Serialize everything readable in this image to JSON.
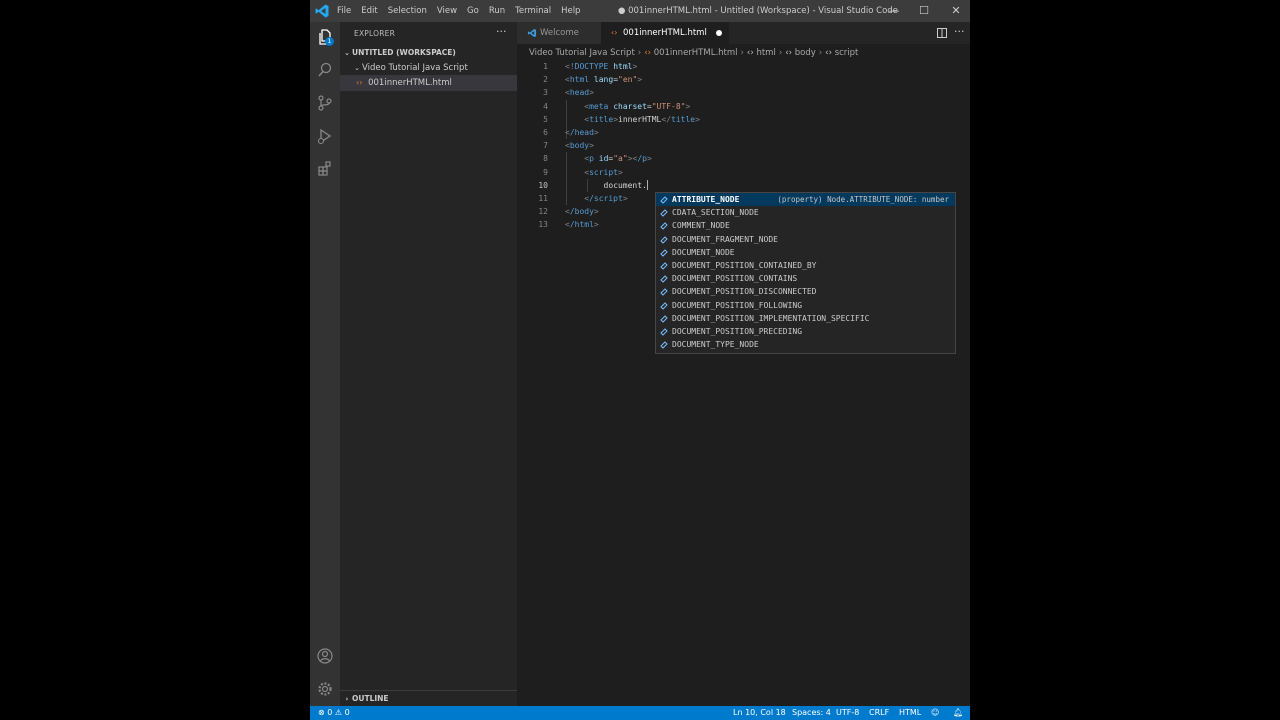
{
  "window": {
    "title": "● 001innerHTML.html - Untitled (Workspace) - Visual Studio Code",
    "menu": [
      "File",
      "Edit",
      "Selection",
      "View",
      "Go",
      "Run",
      "Terminal",
      "Help"
    ],
    "controls": {
      "minimize": "—",
      "maximize": "☐",
      "close": "✕"
    }
  },
  "activity_bar": {
    "explorer_badge": "1",
    "icons": [
      "files-icon",
      "search-icon",
      "source-control-icon",
      "run-debug-icon",
      "extensions-icon",
      "account-icon",
      "settings-gear-icon"
    ]
  },
  "sidebar": {
    "title": "EXPLORER",
    "more": "···",
    "workspace": "UNTITLED (WORKSPACE)",
    "folder": "Video Tutorial Java Script",
    "file": "001innerHTML.html",
    "outline": "OUTLINE"
  },
  "tabs": [
    {
      "label": "Welcome",
      "active": false
    },
    {
      "label": "001innerHTML.html",
      "active": true,
      "dirty": true
    }
  ],
  "breadcrumb": [
    "Video Tutorial Java Script",
    "001innerHTML.html",
    "html",
    "body",
    "script"
  ],
  "editor": {
    "line_numbers": [
      "1",
      "2",
      "3",
      "4",
      "5",
      "6",
      "7",
      "8",
      "9",
      "10",
      "11",
      "12",
      "13"
    ],
    "current_line": 10,
    "code": {
      "l1_open": "<!",
      "l1_kw": "DOCTYPE",
      "l1_attr": "html",
      "l1_close": ">",
      "l2_tag": "html",
      "l2_attr": "lang",
      "l2_val": "\"en\"",
      "l3_tag": "head",
      "l4_tag": "meta",
      "l4_attr": "charset",
      "l4_val": "\"UTF-8\"",
      "l5_tag": "title",
      "l5_text": "innerHTML",
      "l6_tag": "/head",
      "l7_tag": "body",
      "l8_tag": "p",
      "l8_attr": "id",
      "l8_val": "\"a\"",
      "l8_close_tag": "/p",
      "l9_tag": "script",
      "l10_text": "document.",
      "l11_tag": "/script",
      "l12_tag": "/body",
      "l13_tag": "/html"
    }
  },
  "suggestions": {
    "items": [
      "ATTRIBUTE_NODE",
      "CDATA_SECTION_NODE",
      "COMMENT_NODE",
      "DOCUMENT_FRAGMENT_NODE",
      "DOCUMENT_NODE",
      "DOCUMENT_POSITION_CONTAINED_BY",
      "DOCUMENT_POSITION_CONTAINS",
      "DOCUMENT_POSITION_DISCONNECTED",
      "DOCUMENT_POSITION_FOLLOWING",
      "DOCUMENT_POSITION_IMPLEMENTATION_SPECIFIC",
      "DOCUMENT_POSITION_PRECEDING",
      "DOCUMENT_TYPE_NODE"
    ],
    "selected_detail": "(property) Node.ATTRIBUTE_NODE: number"
  },
  "status_bar": {
    "errors": "0",
    "warnings": "0",
    "position": "Ln 10, Col 18",
    "spaces": "Spaces: 4",
    "encoding": "UTF-8",
    "eol": "CRLF",
    "language": "HTML"
  },
  "colors": {
    "accent": "#007acc",
    "titlebar": "#3c3c3c",
    "editor_bg": "#1e1e1e",
    "sidebar_bg": "#252526"
  }
}
